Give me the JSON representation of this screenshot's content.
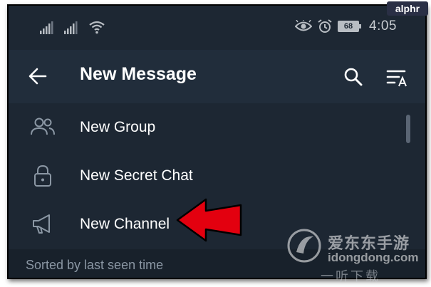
{
  "status_bar": {
    "battery_level": "68",
    "time": "4:05"
  },
  "header": {
    "title": "New Message"
  },
  "menu": {
    "items": [
      {
        "label": "New Group",
        "icon": "group-icon"
      },
      {
        "label": "New Secret Chat",
        "icon": "lock-icon"
      },
      {
        "label": "New Channel",
        "icon": "megaphone-icon"
      }
    ]
  },
  "list": {
    "section_header": "Sorted by last seen time"
  },
  "branding": {
    "badge": "alphr",
    "watermark_title": "爱东东手游",
    "watermark_domain": "idongdong.com",
    "watermark_sub": "一听下载"
  },
  "colors": {
    "background": "#1d2733",
    "appbar": "#212d3b",
    "section_bg": "#18212b",
    "arrow": "#e3000f"
  }
}
